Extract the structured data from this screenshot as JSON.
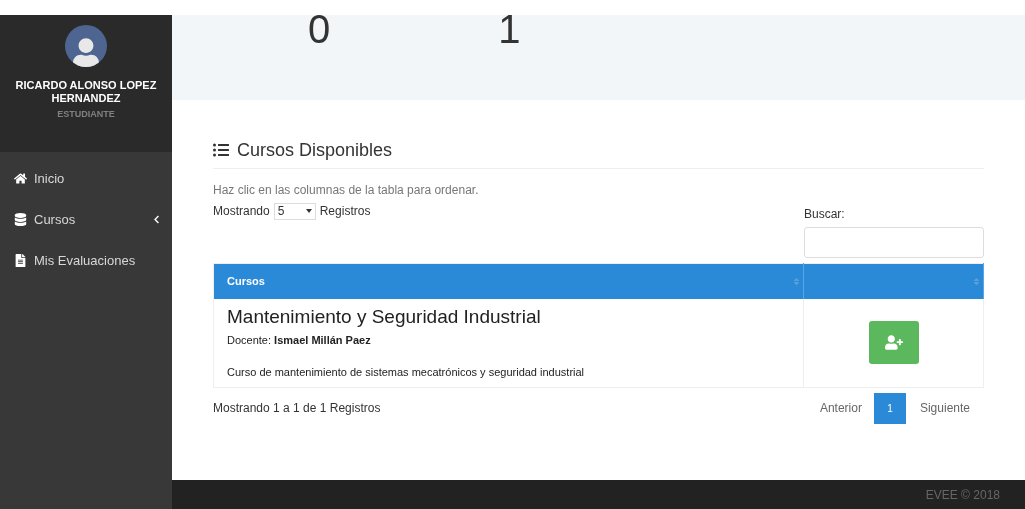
{
  "user": {
    "name": "RICARDO ALONSO LOPEZ HERNANDEZ",
    "role": "ESTUDIANTE"
  },
  "sidebar": {
    "items": [
      {
        "kind": "home",
        "label": "Inicio",
        "expandable": false
      },
      {
        "kind": "database",
        "label": "Cursos",
        "expandable": true
      },
      {
        "kind": "file",
        "label": "Mis Evaluaciones",
        "expandable": false
      }
    ]
  },
  "stats": [
    "0",
    "1"
  ],
  "section": {
    "title": "Cursos Disponibles",
    "hint": "Haz clic en las columnas de la tabla para ordenar.",
    "length_prefix": "Mostrando",
    "length_value": "5",
    "length_suffix": "Registros",
    "search_label": "Buscar:"
  },
  "table": {
    "columns": [
      "Cursos",
      ""
    ],
    "rows": [
      {
        "title": "Mantenimiento y Seguridad Industrial",
        "teacher_label": "Docente:",
        "teacher": "Ismael Millán Paez",
        "description": "Curso de mantenimiento de sistemas mecatrónicos y seguridad industrial"
      }
    ]
  },
  "info": "Mostrando 1 a 1 de 1 Registros",
  "pagination": {
    "previous": "Anterior",
    "pages": [
      {
        "label": "1",
        "selected": true
      }
    ],
    "next": "Siguiente"
  },
  "footer": "EVEE © 2018"
}
